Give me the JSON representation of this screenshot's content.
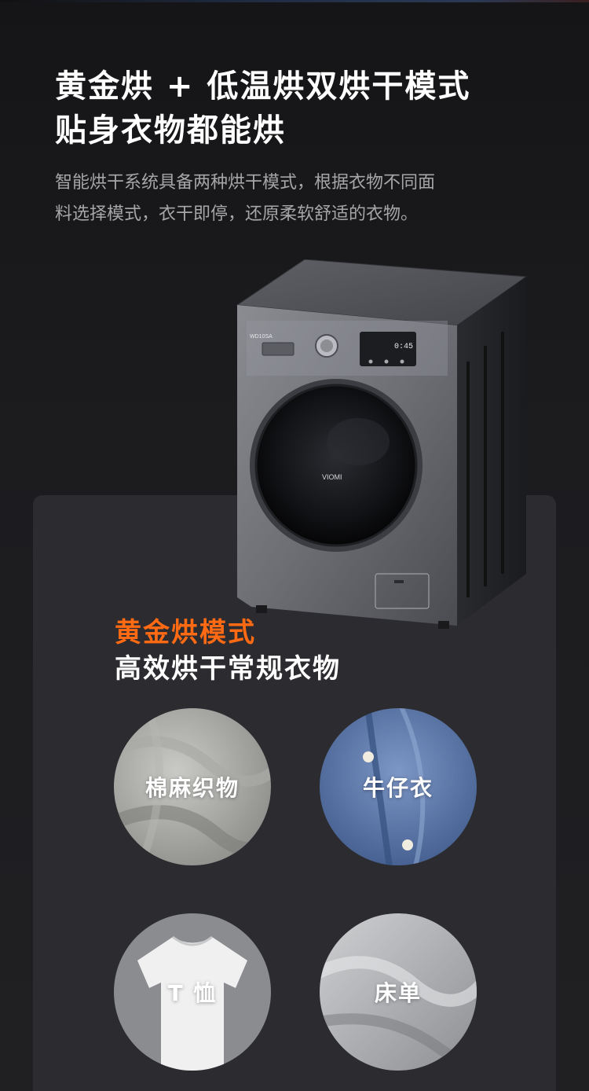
{
  "header": {
    "title_line1": "黄金烘 + 低温烘双烘干模式",
    "title_line2": "贴身衣物都能烘",
    "desc_line1": "智能烘干系统具备两种烘干模式，根据衣物不同面",
    "desc_line2": "料选择模式，衣干即停，还原柔软舒适的衣物。"
  },
  "product": {
    "model_text": "WD10SA",
    "display_value": "0:45",
    "brand": "VIOMI"
  },
  "mode": {
    "title": "黄金烘模式",
    "subtitle": "高效烘干常规衣物"
  },
  "fabrics": [
    {
      "label": "棉麻织物",
      "icon": "linen-fabric-icon"
    },
    {
      "label": "牛仔衣",
      "icon": "denim-shirt-icon"
    },
    {
      "label": "T 恤",
      "icon": "tshirt-icon"
    },
    {
      "label": "床单",
      "icon": "bedsheet-icon"
    }
  ],
  "colors": {
    "accent": "#ff6a13",
    "background": "#1a1a1c",
    "panel": "#2c2c30"
  }
}
